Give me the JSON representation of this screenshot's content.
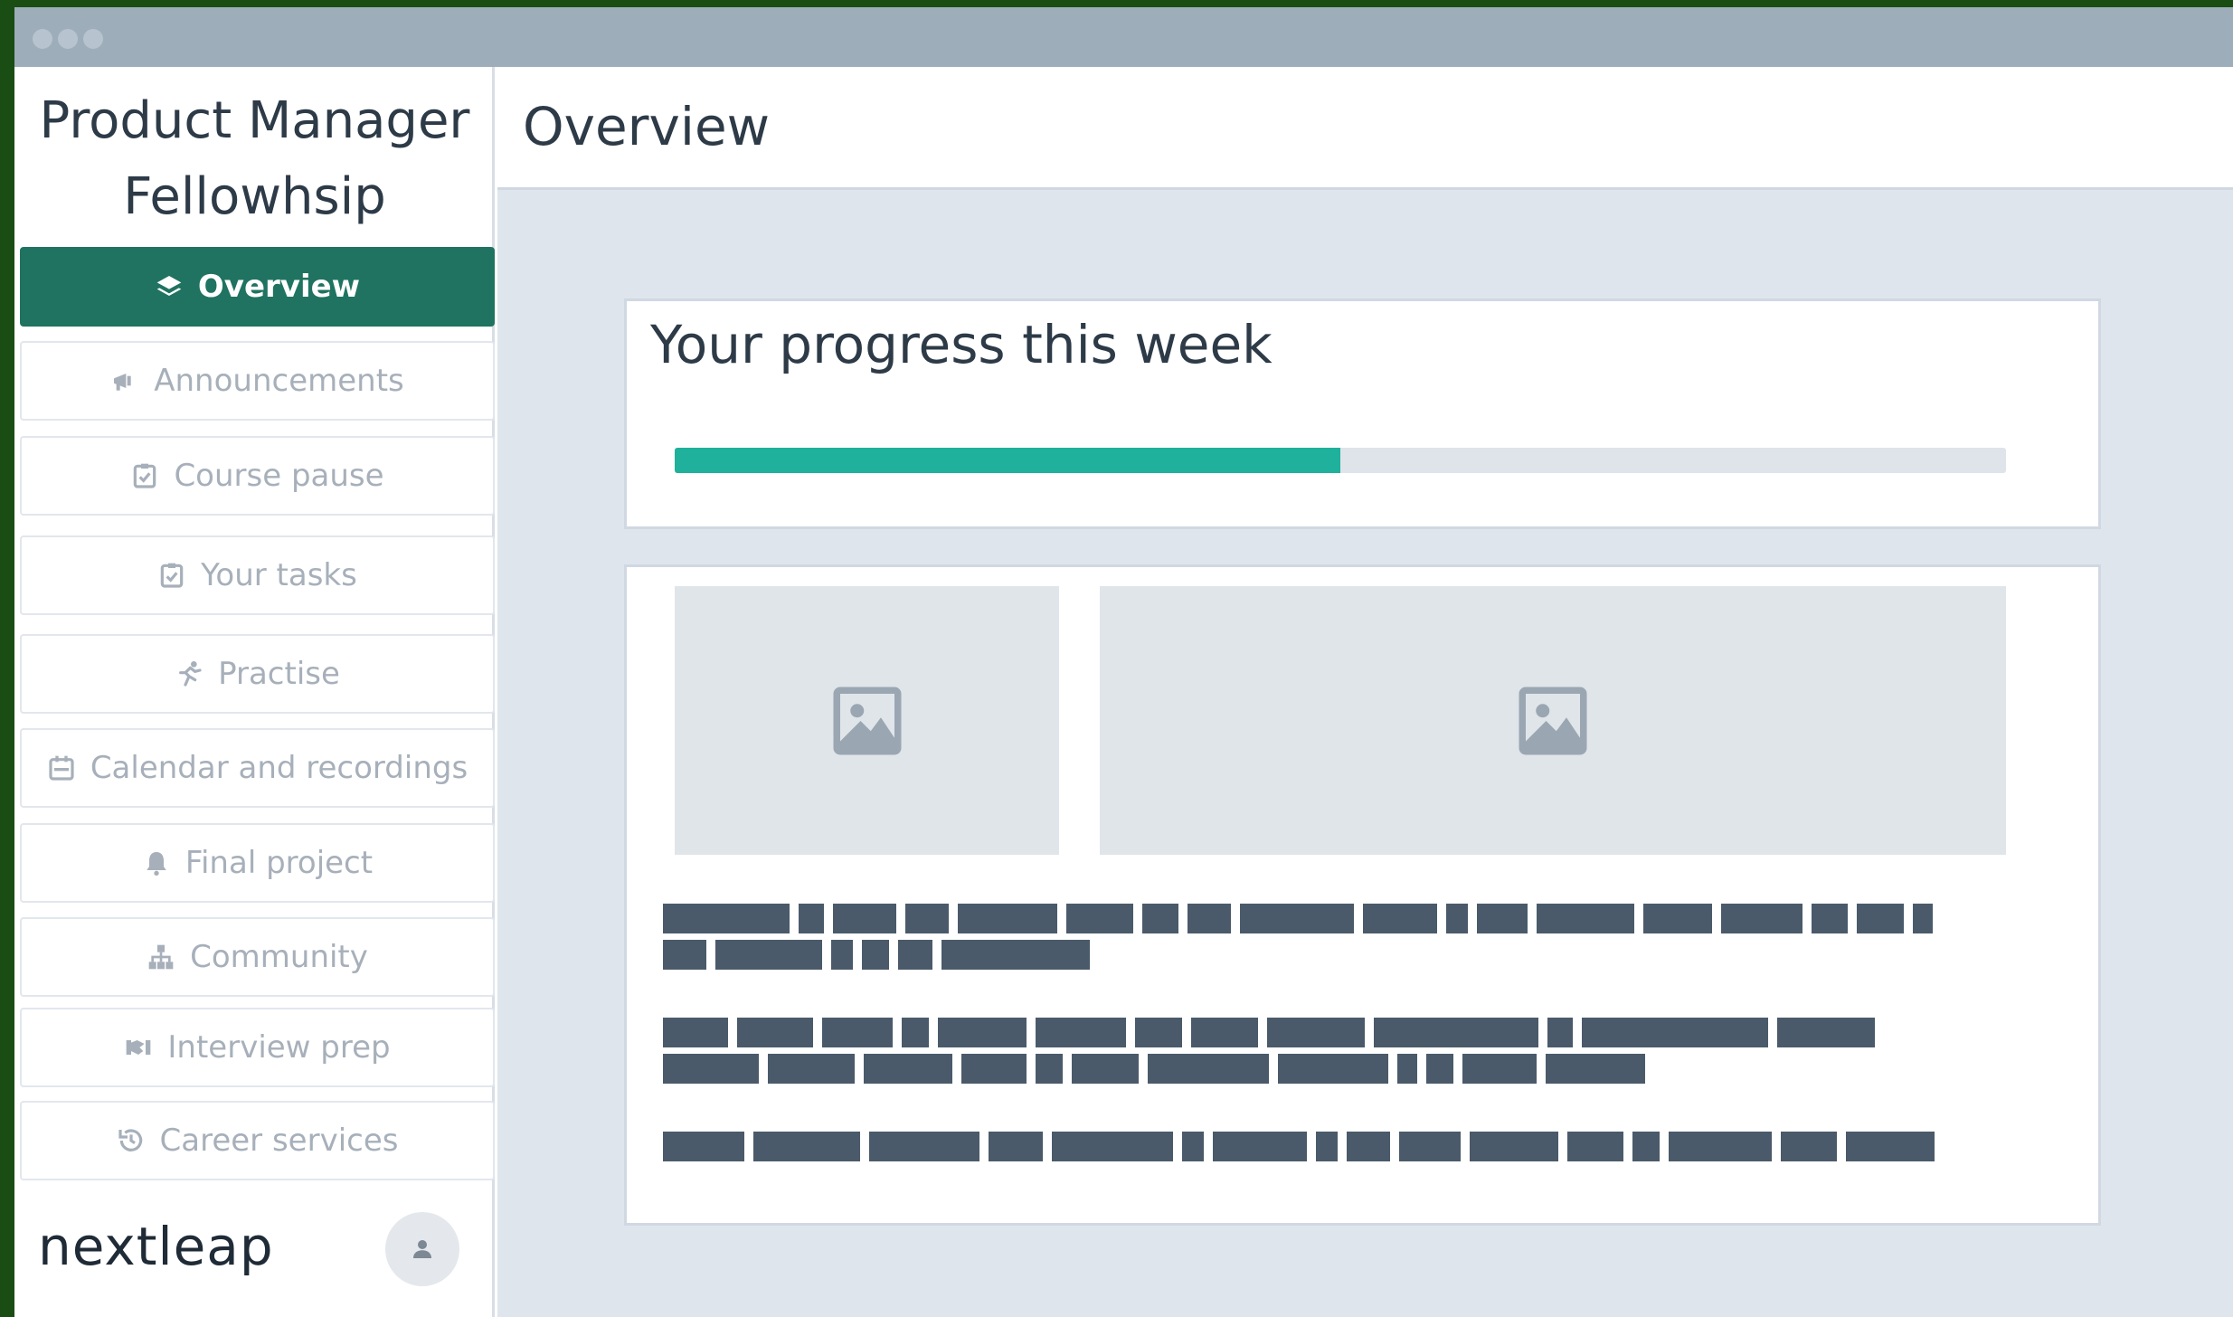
{
  "app": {
    "title_line1": "Product Manager",
    "title_line2": "Fellowhsip",
    "brand": "nextleap"
  },
  "sidebar": {
    "items": [
      {
        "label": "Overview",
        "icon": "layers-icon",
        "active": true
      },
      {
        "label": "Announcements",
        "icon": "megaphone-icon",
        "active": false
      },
      {
        "label": "Course pause",
        "icon": "clipboard-check-icon",
        "active": false
      },
      {
        "label": "Your tasks",
        "icon": "clipboard-check-icon",
        "active": false
      },
      {
        "label": "Practise",
        "icon": "running-icon",
        "active": false
      },
      {
        "label": "Calendar and recordings",
        "icon": "calendar-icon",
        "active": false
      },
      {
        "label": "Final project",
        "icon": "bell-icon",
        "active": false
      },
      {
        "label": "Community",
        "icon": "sitemap-icon",
        "active": false
      },
      {
        "label": "Interview prep",
        "icon": "handshake-icon",
        "active": false
      },
      {
        "label": "Career services",
        "icon": "history-icon",
        "active": false
      }
    ]
  },
  "main": {
    "title": "Overview",
    "progress": {
      "title": "Your progress this week",
      "value_percent": 50
    }
  },
  "colors": {
    "active_nav": "#1f7360",
    "progress_fill": "#1fb19b",
    "window_bg": "#1a4d14"
  }
}
